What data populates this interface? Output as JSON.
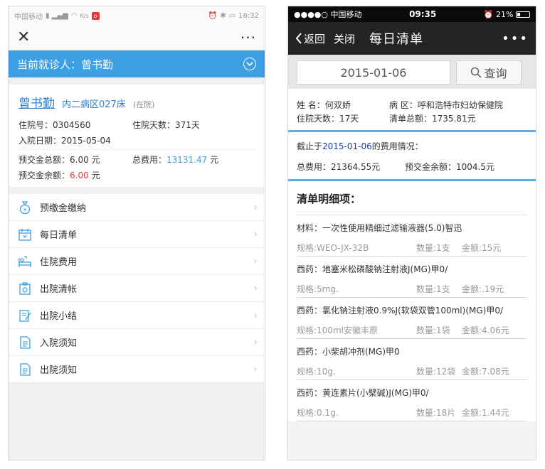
{
  "left": {
    "status_bar": {
      "carrier": "中国移动",
      "network": "K/s",
      "time": "16:32"
    },
    "nav": {
      "close_icon": "close-icon",
      "more": "···"
    },
    "patient_bar": {
      "label": "当前就诊人：曾书勤"
    },
    "card": {
      "name": "曾书勤",
      "ward": "内二病区027床",
      "status": "(在院)",
      "admission_no": "住院号：0304560",
      "days": "住院天数：371天",
      "admit_date": "入院日期：2015-05-04",
      "prepaid_total": "预交金总额：6.00 元",
      "total_fee_label": "总费用：",
      "total_fee_value": "13131.47",
      "yuan": "元",
      "prepaid_balance_label": "预交金余额：",
      "prepaid_balance_value": "6.00",
      "accent": "#3d9fe4",
      "alert": "#e33333"
    },
    "menu": [
      {
        "label": "预缴金缴纳",
        "icon": "moneybag-icon"
      },
      {
        "label": "每日清单",
        "icon": "calendar-icon"
      },
      {
        "label": "住院费用",
        "icon": "hospital-bed-icon"
      },
      {
        "label": "出院清帐",
        "icon": "ledger-icon"
      },
      {
        "label": "出院小结",
        "icon": "edit-document-icon"
      },
      {
        "label": "入院须知",
        "icon": "document-icon"
      },
      {
        "label": "出院须知",
        "icon": "document-icon"
      }
    ]
  },
  "right": {
    "status_bar": {
      "carrier": "●●●●○ 中国移动",
      "time": "09:35",
      "battery": "21%"
    },
    "nav": {
      "back": "返回",
      "close": "关闭",
      "title": "每日清单",
      "more": "•••"
    },
    "search": {
      "date": "2015-01-06",
      "query": "查询"
    },
    "info": {
      "name": "姓  名：何双娇",
      "ward": "病  区：呼和浩特市妇幼保健院",
      "days": "住院天数：17天",
      "bill_total": "清单总额：1735.81元"
    },
    "summary": {
      "as_of_prefix": "截止于",
      "as_of_date": "2015-01-06",
      "as_of_suffix": "的费用情况：",
      "total": "总费用：21364.55元",
      "balance": "预交金余额：1004.5元"
    },
    "detail_title": "清单明细项：",
    "items": [
      {
        "name": "材料：一次性使用精细过滤输液器(5.0)智迅",
        "spec": "规格:WEO-JX-32B",
        "qty": "数量:1支",
        "amount": "金额:15元"
      },
      {
        "name": "西药：地塞米松磷酸钠注射液J(MG)甲0/",
        "spec": "规格:5mg.",
        "qty": "数量:1支",
        "amount": "金额:.19元"
      },
      {
        "name": "西药：氯化钠注射液0.9%J(软袋双管100ml)(MG)甲0/",
        "spec": "规格:100ml安徽丰原",
        "qty": "数量:1袋",
        "amount": "金额:4.06元"
      },
      {
        "name": "西药：小柴胡冲剂(MG)甲0",
        "spec": "规格:10g.",
        "qty": "数量:12袋",
        "amount": "金额:7.08元"
      },
      {
        "name": "西药：黄连素片(小檗碱)J(MG)甲0/",
        "spec": "规格:0.1g.",
        "qty": "数量:18片",
        "amount": "金额:1.44元"
      }
    ]
  }
}
